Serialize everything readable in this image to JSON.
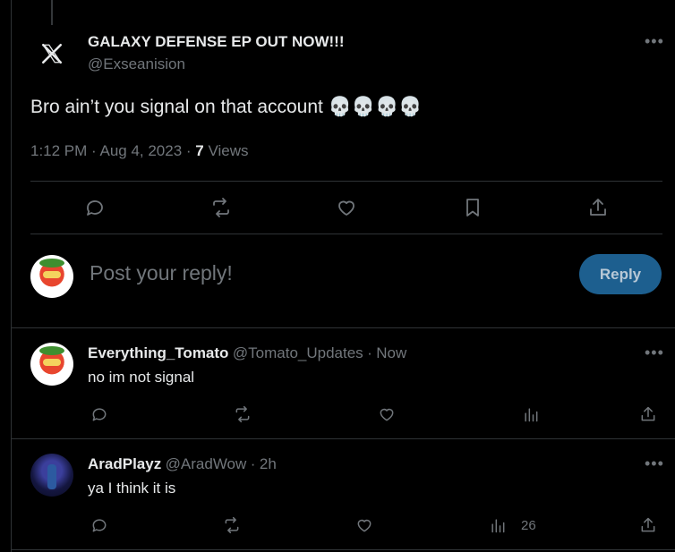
{
  "tweet": {
    "author_name": "GALAXY DEFENSE EP OUT NOW!!!",
    "author_handle": "@Exseanision",
    "text": "Bro ain’t you signal on that account 💀💀💀💀",
    "time": "1:12 PM",
    "date": "Aug 4, 2023",
    "views_count": "7",
    "views_label": "Views",
    "avatar_icon": "x-logo-icon"
  },
  "reply_box": {
    "placeholder": "Post your reply!",
    "button": "Reply",
    "button_color": "#1d5f8f"
  },
  "replies": [
    {
      "name": "Everything_Tomato",
      "handle": "@Tomato_Updates",
      "time": "Now",
      "text": "no im not signal",
      "views": ""
    },
    {
      "name": "AradPlayz",
      "handle": "@AradWow",
      "time": "2h",
      "text": "ya I think it is",
      "views": "26"
    }
  ],
  "colors": {
    "background": "#000000",
    "text": "#e7e9ea",
    "muted": "#71767b",
    "border": "#2f3336"
  }
}
